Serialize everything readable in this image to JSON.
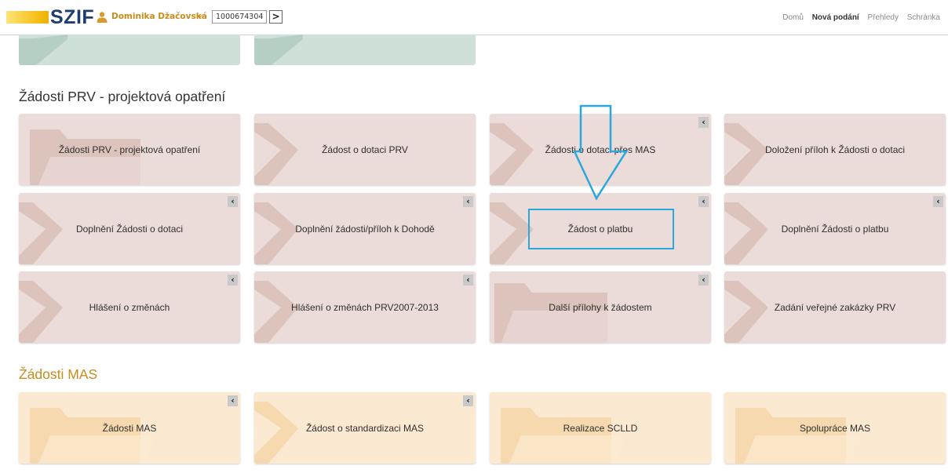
{
  "header": {
    "logo_text": "SZIF",
    "user_name": "Dominika Džačovská",
    "client_id": "1000674304",
    "go_symbol": ">",
    "nav": [
      {
        "label": "Domů",
        "active": false
      },
      {
        "label": "Nová podání",
        "active": true
      },
      {
        "label": "Přehledy",
        "active": false
      },
      {
        "label": "Schránka",
        "active": false
      }
    ]
  },
  "sections": [
    {
      "title": "Žádosti PRV - projektová opatření",
      "title_color": "#333333",
      "tiles": [
        {
          "label": "Žádosti PRV - projektová opatření",
          "collapse": false,
          "icon": "folder-icon"
        },
        {
          "label": "Žádost o dotaci PRV",
          "collapse": false,
          "icon": "chevron-icon"
        },
        {
          "label": "Žádosti o dotaci přes MAS",
          "collapse": true,
          "icon": "chevron-icon"
        },
        {
          "label": "Doložení příloh k Žádosti o dotaci",
          "collapse": false,
          "icon": "chevron-icon"
        },
        {
          "label": "Doplnění Žádosti o dotaci",
          "collapse": true,
          "icon": "chevron-icon"
        },
        {
          "label": "Doplnění žádosti/příloh k Dohodě",
          "collapse": true,
          "icon": "chevron-icon"
        },
        {
          "label": "Žádost o platbu",
          "collapse": true,
          "icon": "chevron-icon"
        },
        {
          "label": "Doplnění Žádosti o platbu",
          "collapse": true,
          "icon": "chevron-icon"
        },
        {
          "label": "Hlášení o změnách",
          "collapse": true,
          "icon": "chevron-icon"
        },
        {
          "label": "Hlášení o změnách PRV2007-2013",
          "collapse": true,
          "icon": "chevron-icon"
        },
        {
          "label": "Další přílohy k žádostem",
          "collapse": true,
          "icon": "folder-icon"
        },
        {
          "label": "Zadání veřejné zakázky PRV",
          "collapse": false,
          "icon": "chevron-icon"
        }
      ]
    },
    {
      "title": "Žádosti MAS",
      "title_color": "#c98b1c",
      "tiles": [
        {
          "label": "Žádosti MAS",
          "collapse": true,
          "icon": "folder-icon"
        },
        {
          "label": "Žádost o standardizaci MAS",
          "collapse": true,
          "icon": "chevron-icon"
        },
        {
          "label": "Realizace SCLLD",
          "collapse": false,
          "icon": "folder-icon"
        },
        {
          "label": "Spolupráce MAS",
          "collapse": false,
          "icon": "folder-icon"
        }
      ]
    }
  ],
  "collapse_symbol": "‹",
  "colors": {
    "prv_tile": "#ebdcd9",
    "mas_tile": "#fce9d2",
    "annotation": "#2aa7dc",
    "top_tile": "#cfe0d8"
  }
}
